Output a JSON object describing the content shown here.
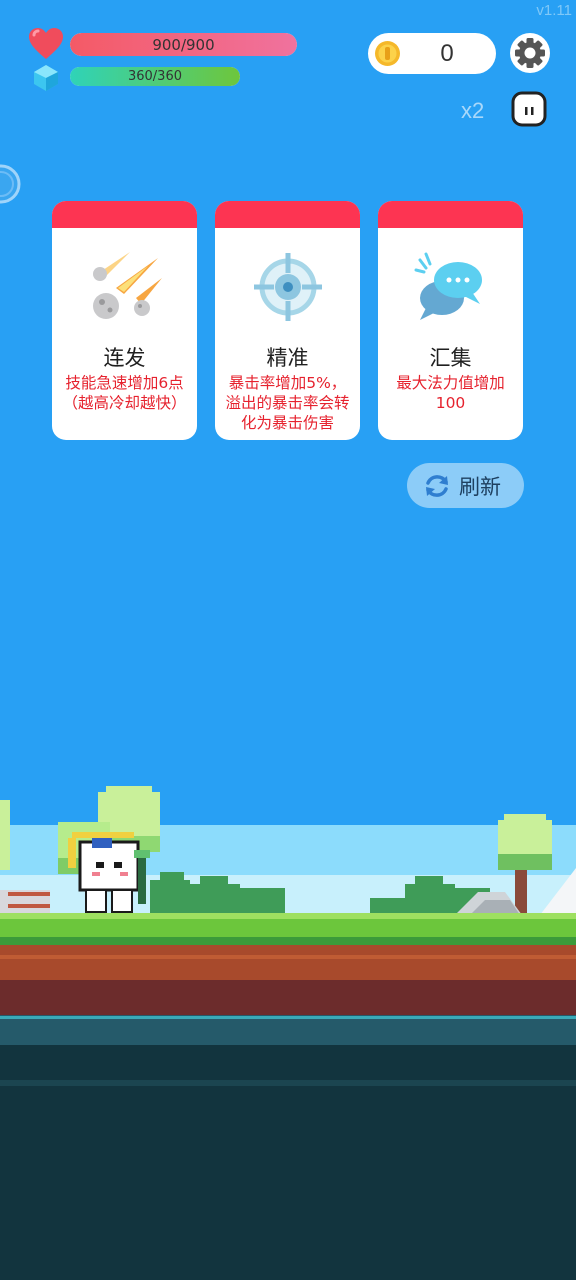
{
  "version": "v1.11",
  "hud": {
    "hp_text": "900/900",
    "hp_fraction": 1.0,
    "mp_text": "360/360",
    "mp_fraction": 1.0,
    "coins": "0",
    "speed_label": "x2"
  },
  "cards": [
    {
      "title": "连发",
      "desc": "技能急速增加6点（越高冷却越快）",
      "icon": "meteor-icon"
    },
    {
      "title": "精准",
      "desc": "暴击率增加5%，溢出的暴击率会转化为暴击伤害",
      "icon": "crosshair-icon"
    },
    {
      "title": "汇集",
      "desc": "最大法力值增加100",
      "icon": "chat-bubbles-icon"
    }
  ],
  "refresh_label": "刷新",
  "colors": {
    "sky": "#28a0f4",
    "card_header": "#fd3452",
    "card_desc": "#e6222e",
    "hp_fill": "#f45a66",
    "mp_fill": "#2fd3b8"
  }
}
